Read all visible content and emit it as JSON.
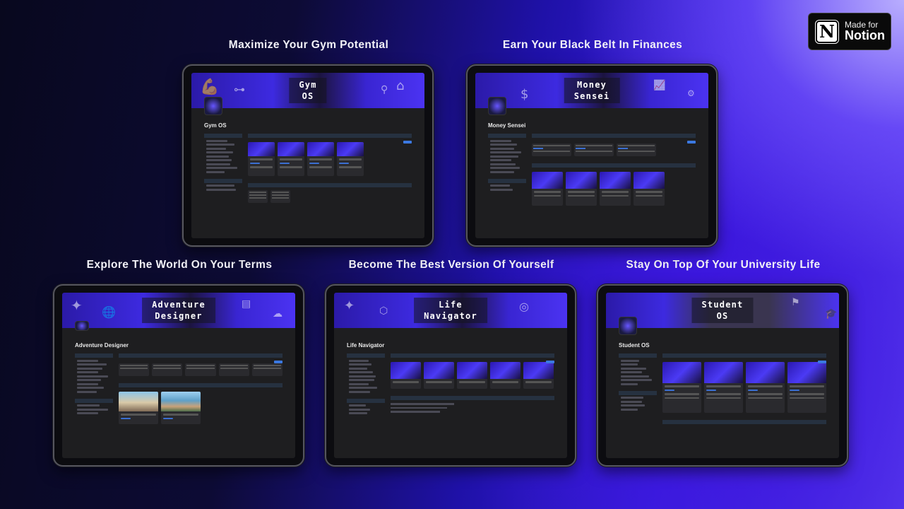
{
  "badge": {
    "line1": "Made for",
    "line2": "Notion",
    "logo_letter": "N"
  },
  "templates": [
    {
      "caption": "Maximize Your Gym Potential",
      "banner_title_line1": "Gym",
      "banner_title_line2": "OS",
      "page_title": "Gym OS"
    },
    {
      "caption": "Earn Your Black Belt In Finances",
      "banner_title_line1": "Money",
      "banner_title_line2": "Sensei",
      "page_title": "Money Sensei"
    },
    {
      "caption": "Explore The World On Your Terms",
      "banner_title_line1": "Adventure",
      "banner_title_line2": "Designer",
      "page_title": "Adventure Designer"
    },
    {
      "caption": "Become The Best Version Of Yourself",
      "banner_title_line1": "Life",
      "banner_title_line2": "Navigator",
      "page_title": "Life Navigator"
    },
    {
      "caption": "Stay On Top Of Your University Life",
      "banner_title_line1": "Student",
      "banner_title_line2": "OS",
      "page_title": "Student OS"
    }
  ],
  "colors": {
    "accent": "#3b78e0",
    "banner_purple": "#3d2ae0",
    "screen_bg": "#1e1e20"
  }
}
